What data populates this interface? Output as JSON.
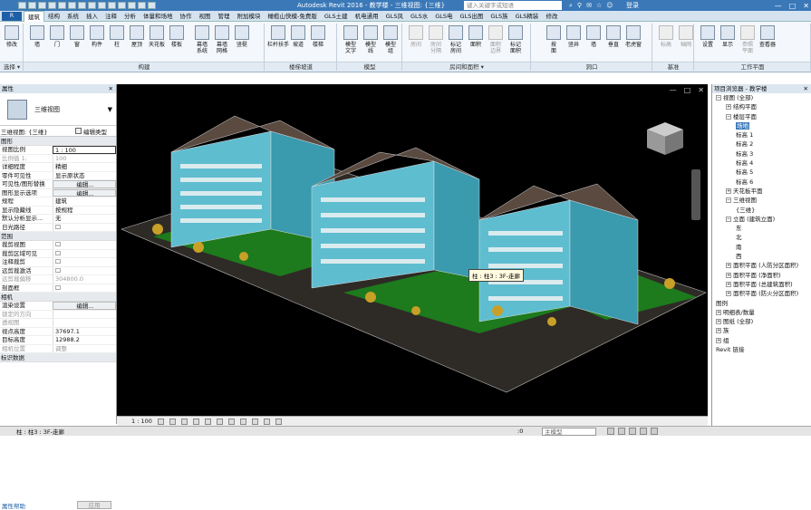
{
  "app": {
    "title": "Autodesk Revit 2016 -  教学楼 - 三维视图: {三维}",
    "search_placeholder": "键入关键字或短语",
    "login": "登录",
    "window_buttons": [
      "—",
      "□",
      "✕"
    ]
  },
  "tabs": [
    "建筑",
    "结构",
    "系统",
    "插入",
    "注释",
    "分析",
    "体量和场地",
    "协作",
    "视图",
    "管理",
    "附加模块",
    "橄榄山快模-免费版",
    "GLS土建",
    "机电通用",
    "GLS风",
    "GLS水",
    "GLS电",
    "GLS出图",
    "GLS族",
    "GLS精装",
    "修改"
  ],
  "file_btn": "R",
  "ribbon": {
    "buttons": [
      {
        "label": "修改",
        "gray": false
      },
      {
        "label": "墙",
        "gray": false
      },
      {
        "label": "门",
        "gray": false
      },
      {
        "label": "窗",
        "gray": false
      },
      {
        "label": "构件",
        "gray": false
      },
      {
        "label": "柱",
        "gray": false
      },
      {
        "label": "屋顶",
        "gray": false
      },
      {
        "label": "天花板",
        "gray": false
      },
      {
        "label": "楼板",
        "gray": false
      },
      {
        "label": "幕墙\n系统",
        "gray": false
      },
      {
        "label": "幕墙\n网格",
        "gray": false
      },
      {
        "label": "竖梃",
        "gray": false
      },
      {
        "label": "栏杆扶手",
        "gray": false
      },
      {
        "label": "坡道",
        "gray": false
      },
      {
        "label": "楼梯",
        "gray": false
      },
      {
        "label": "模型\n文字",
        "gray": false
      },
      {
        "label": "模型\n线",
        "gray": false
      },
      {
        "label": "模型\n组",
        "gray": false
      },
      {
        "label": "房间",
        "gray": true
      },
      {
        "label": "房间\n分隔",
        "gray": true
      },
      {
        "label": "标记\n房间",
        "gray": false
      },
      {
        "label": "面积",
        "gray": false
      },
      {
        "label": "面积\n边界",
        "gray": true
      },
      {
        "label": "标记\n面积",
        "gray": false
      },
      {
        "label": "按\n面",
        "gray": false
      },
      {
        "label": "竖井",
        "gray": false
      },
      {
        "label": "墙",
        "gray": false
      },
      {
        "label": "垂直",
        "gray": false
      },
      {
        "label": "老虎窗",
        "gray": false
      },
      {
        "label": "标高",
        "gray": true
      },
      {
        "label": "轴网",
        "gray": true
      },
      {
        "label": "设置",
        "gray": false
      },
      {
        "label": "显示",
        "gray": false
      },
      {
        "label": "参照\n平面",
        "gray": true
      },
      {
        "label": "查看器",
        "gray": false
      }
    ],
    "panels": [
      "选择 ▾",
      "构建",
      "楼梯坡道",
      "模型",
      "房间和面积 ▾",
      "洞口",
      "基准",
      "工作平面"
    ]
  },
  "properties": {
    "header": "属性",
    "type_name": "三维视图",
    "view_selector": "三维视图: {三维}",
    "edit_type": "编辑类型",
    "groups": [
      {
        "name": "图形",
        "rows": [
          {
            "k": "视图比例",
            "v": "1 : 100",
            "box": true
          },
          {
            "k": "比例值 1:",
            "v": "100",
            "dis": true
          },
          {
            "k": "详细程度",
            "v": "精细"
          },
          {
            "k": "零件可见性",
            "v": "显示原状态"
          },
          {
            "k": "可见性/图形替换",
            "v": "编辑...",
            "btn": true
          },
          {
            "k": "图形显示选项",
            "v": "编辑...",
            "btn": true
          },
          {
            "k": "规程",
            "v": "建筑"
          },
          {
            "k": "显示隐藏线",
            "v": "按规程"
          },
          {
            "k": "默认分析显示...",
            "v": "无"
          },
          {
            "k": "日光路径",
            "v": "☐"
          }
        ]
      },
      {
        "name": "范围",
        "rows": [
          {
            "k": "裁剪视图",
            "v": "☐"
          },
          {
            "k": "裁剪区域可见",
            "v": "☐"
          },
          {
            "k": "注释裁剪",
            "v": "☐"
          },
          {
            "k": "远剪裁激活",
            "v": "☐"
          },
          {
            "k": "远剪裁偏移",
            "v": "304800.0",
            "dis": true
          },
          {
            "k": "剖面框",
            "v": "☐"
          }
        ]
      },
      {
        "name": "相机",
        "rows": [
          {
            "k": "渲染设置",
            "v": "编辑...",
            "btn": true
          },
          {
            "k": "锁定的方向",
            "v": "",
            "dis": true
          },
          {
            "k": "透视图",
            "v": "",
            "dis": true
          },
          {
            "k": "视点高度",
            "v": "37697.1"
          },
          {
            "k": "目标高度",
            "v": "12988.2"
          },
          {
            "k": "相机位置",
            "v": "调整",
            "dis": true
          }
        ]
      },
      {
        "name": "标识数据",
        "rows": []
      }
    ],
    "footer_link": "属性帮助",
    "apply": "应用"
  },
  "canvas": {
    "tooltip": "柱 : 柱3 : 3F-走廊",
    "controls": [
      "—",
      "□",
      "✕"
    ]
  },
  "viewbar": {
    "scale": "1 : 100"
  },
  "browser": {
    "header": "项目浏览器 - 教学楼",
    "items": [
      {
        "t": "视图 (全部)",
        "lvl": 0,
        "tg": "−"
      },
      {
        "t": "结构平面",
        "lvl": 1,
        "tg": "+"
      },
      {
        "t": "楼层平面",
        "lvl": 1,
        "tg": "−"
      },
      {
        "t": "场地",
        "lvl": 2,
        "hl": true
      },
      {
        "t": "标高 1",
        "lvl": 2
      },
      {
        "t": "标高 2",
        "lvl": 2
      },
      {
        "t": "标高 3",
        "lvl": 2
      },
      {
        "t": "标高 4",
        "lvl": 2
      },
      {
        "t": "标高 5",
        "lvl": 2
      },
      {
        "t": "标高 6",
        "lvl": 2
      },
      {
        "t": "天花板平面",
        "lvl": 1,
        "tg": "+"
      },
      {
        "t": "三维视图",
        "lvl": 1,
        "tg": "−"
      },
      {
        "t": "{三维}",
        "lvl": 2
      },
      {
        "t": "立面 (建筑立面)",
        "lvl": 1,
        "tg": "−"
      },
      {
        "t": "东",
        "lvl": 2
      },
      {
        "t": "北",
        "lvl": 2
      },
      {
        "t": "南",
        "lvl": 2
      },
      {
        "t": "西",
        "lvl": 2
      },
      {
        "t": "面积平面 (人防分区面积)",
        "lvl": 1,
        "tg": "+"
      },
      {
        "t": "面积平面 (净面积)",
        "lvl": 1,
        "tg": "+"
      },
      {
        "t": "面积平面 (总建筑面积)",
        "lvl": 1,
        "tg": "+"
      },
      {
        "t": "面积平面 (防火分区面积)",
        "lvl": 1,
        "tg": "+"
      },
      {
        "t": "图例",
        "lvl": 0
      },
      {
        "t": "明细表/数量",
        "lvl": 0,
        "tg": "+"
      },
      {
        "t": "图纸 (全部)",
        "lvl": 0,
        "tg": "+"
      },
      {
        "t": "族",
        "lvl": 0,
        "tg": "+"
      },
      {
        "t": "组",
        "lvl": 0,
        "tg": "+"
      },
      {
        "t": "Revit 链接",
        "lvl": 0
      }
    ]
  },
  "status": {
    "left": "柱 : 柱3 : 3F-走廊",
    "zero": ":0",
    "model": "主模型"
  }
}
